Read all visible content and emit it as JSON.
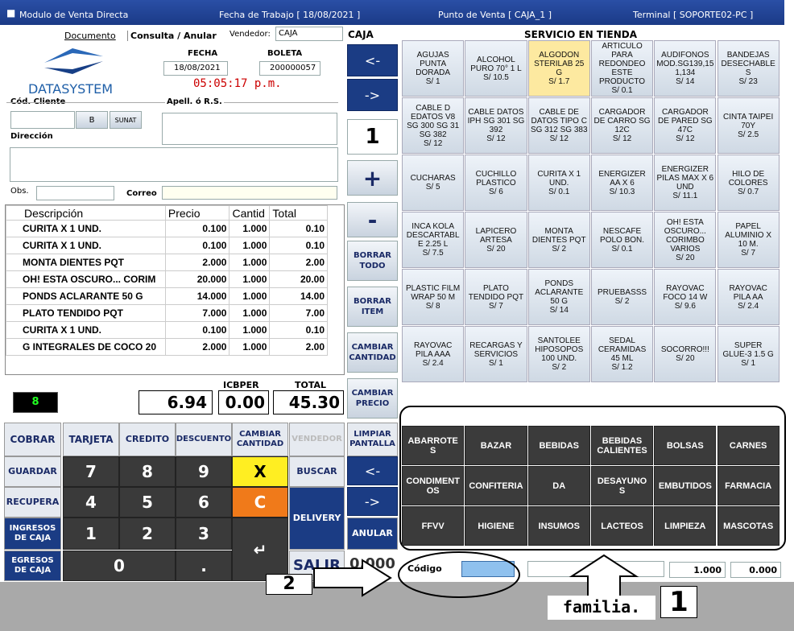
{
  "window": {
    "title": "Modulo de Venta Directa",
    "work_date": "Fecha de Trabajo [ 18/08/2021 ]",
    "point_of_sale": "Punto de Venta [ CAJA_1 ]",
    "terminal": "Terminal [ SOPORTE02-PC ]"
  },
  "tabs": {
    "documento": "Documento",
    "consulta": "Consulta / Anular",
    "vendedor_label": "Vendedor:",
    "vendedor_value": "CAJA",
    "caja": "CAJA"
  },
  "header": {
    "logo_text": "DATASYSTEM",
    "fecha_label": "FECHA",
    "fecha_value": "18/08/2021",
    "boleta_label": "BOLETA",
    "boleta_value": "200000057",
    "time": "05:05:17 p.m."
  },
  "client": {
    "cod_label": "Cód. Cliente",
    "apell_label": "Apell. ó R.S.",
    "b_button": "B",
    "sunat_button": "SUNAT",
    "direccion_label": "Dirección",
    "obs_label": "Obs.",
    "correo_label": "Correo"
  },
  "items_table": {
    "headers": [
      "Descripción",
      "Precio",
      "Cantid",
      "Total"
    ],
    "rows": [
      [
        "CURITA X 1 UND.",
        "0.100",
        "1.000",
        "0.10"
      ],
      [
        "CURITA X 1 UND.",
        "0.100",
        "1.000",
        "0.10"
      ],
      [
        "MONTA DIENTES PQT",
        "2.000",
        "1.000",
        "2.00"
      ],
      [
        "OH! ESTA OSCURO... CORIM",
        "20.000",
        "1.000",
        "20.00"
      ],
      [
        "PONDS ACLARANTE 50 G",
        "14.000",
        "1.000",
        "14.00"
      ],
      [
        "PLATO TENDIDO PQT",
        "7.000",
        "1.000",
        "7.00"
      ],
      [
        "CURITA X 1 UND.",
        "0.100",
        "1.000",
        "0.10"
      ],
      [
        "G INTEGRALES DE COCO 20",
        "2.000",
        "1.000",
        "2.00"
      ]
    ]
  },
  "totals": {
    "count": "8",
    "subtotal": "6.94",
    "icbper_label": "ICBPER",
    "icbper": "0.00",
    "total_label": "TOTAL",
    "total": "45.30"
  },
  "nav": {
    "prev": "<-",
    "next": "->",
    "qty": "1",
    "plus": "+",
    "minus": "-"
  },
  "side_buttons": [
    "BORRAR\nTODO",
    "BORRAR\nITEM",
    "CAMBIAR\nCANTIDAD",
    "CAMBIAR\nPRECIO",
    "LIMPIAR\nPANTALLA"
  ],
  "products": {
    "title": "SERVICIO EN TIENDA",
    "items": [
      "AGUJAS\nPUNTA\nDORADA\nS/ 1",
      "ALCOHOL\nPURO 70° 1 L\nS/ 10.5",
      "ALGODON\nSTERILAB 25\nG\nS/ 1.7",
      "ARTICULO\nPARA\nREDONDEO\nESTE\nPRODUCTO\nS/ 0.1",
      "AUDIFONOS\nMOD.SG139,15\n1,134\nS/ 14",
      "BANDEJAS\nDESECHABLE\nS\nS/ 23",
      "CABLE D\nEDATOS V8\nSG 300 SG 31\nSG 382\nS/ 12",
      "CABLE DATOS\nIPH SG 301 SG\n392\nS/ 12",
      "CABLE DE\nDATOS TIPO C\nSG 312 SG 383\nS/ 12",
      "CARGADOR\nDE CARRO SG\n12C\nS/ 12",
      "CARGADOR\nDE PARED SG\n47C\nS/ 12",
      "CINTA TAIPEI\n70Y\nS/ 2.5",
      "CUCHARAS\nS/ 5",
      "CUCHILLO\nPLASTICO\nS/ 6",
      "CURITA X 1\nUND.\nS/ 0.1",
      "ENERGIZER\nAA X 6\nS/ 10.3",
      "ENERGIZER\nPILAS MAX X 6\nUND\nS/ 11.1",
      "HILO DE\nCOLORES\nS/ 0.7",
      "INCA KOLA\nDESCARTABL\nE 2.25 L\nS/ 7.5",
      "LAPICERO\nARTESA\nS/ 20",
      "MONTA\nDIENTES PQT\nS/ 2",
      "NESCAFE\nPOLO BON.\nS/ 0.1",
      "OH! ESTA\nOSCURO...\nCORIMBO\nVARIOS\nS/ 20",
      "PAPEL\nALUMINIO X\n10 M.\nS/ 7",
      "PLASTIC FILM\nWRAP 50 M\nS/ 8",
      "PLATO\nTENDIDO PQT\nS/ 7",
      "PONDS\nACLARANTE\n50 G\nS/ 14",
      "PRUEBASSS\nS/ 2",
      "RAYOVAC\nFOCO 14 W\nS/ 9.6",
      "RAYOVAC\nPILA AA\nS/ 2.4",
      "RAYOVAC\nPILA AAA\nS/ 2.4",
      "RECARGAS Y\nSERVICIOS\nS/ 1",
      "SANTOLEE\nHIPOSOPOS\n100 UND.\nS/ 2",
      "SEDAL\nCERAMIDAS\n45 ML\nS/ 1.2",
      "SOCORRO!!!\nS/ 20",
      "SUPER\nGLUE-3 1.5 G\nS/ 1"
    ]
  },
  "families": [
    "ABARROTE\nS",
    "BAZAR",
    "BEBIDAS",
    "BEBIDAS\nCALIENTES",
    "BOLSAS",
    "CARNES",
    "CONDIMENT\nOS",
    "CONFITERIA",
    "DA",
    "DESAYUNO\nS",
    "EMBUTIDOS",
    "FARMACIA",
    "FFVV",
    "HIGIENE",
    "INSUMOS",
    "LACTEOS",
    "LIMPIEZA",
    "MASCOTAS"
  ],
  "keypad": {
    "cobrar": "COBRAR",
    "tarjeta": "TARJETA",
    "credito": "CREDITO",
    "descuento": "DESCUENTO",
    "cambiar_cantidad": "CAMBIAR\nCANTIDAD",
    "vendedor": "VENDEDOR",
    "limpiar": "LIMPIAR\nPANTALLA",
    "guardar": "GUARDAR",
    "recupera": "RECUPERA",
    "ingresos": "INGRESOS\nDE CAJA",
    "egresos": "EGRESOS\nDE CAJA",
    "buscar": "BUSCAR",
    "delivery": "DELIVERY",
    "anular": "ANULAR",
    "salir": "SALIR",
    "x": "X",
    "c": "C",
    "k7": "7",
    "k8": "8",
    "k9": "9",
    "k4": "4",
    "k5": "5",
    "k6": "6",
    "k1": "1",
    "k2": "2",
    "k3": "3",
    "k0": "0",
    "dot": ".",
    "enter": "↵",
    "left": "<-",
    "right": "->"
  },
  "bottom": {
    "codigo_label": "Código",
    "qty": "1.000",
    "price": "0.000",
    "overlay_value": "0.000"
  },
  "annotations": {
    "label1": "1",
    "label2": "2",
    "familia": "familia."
  },
  "colors": {
    "nav_blue": "#1b3c84",
    "highlight": "#fde9a0",
    "yellow": "#ffee22",
    "orange": "#f07a1a"
  }
}
